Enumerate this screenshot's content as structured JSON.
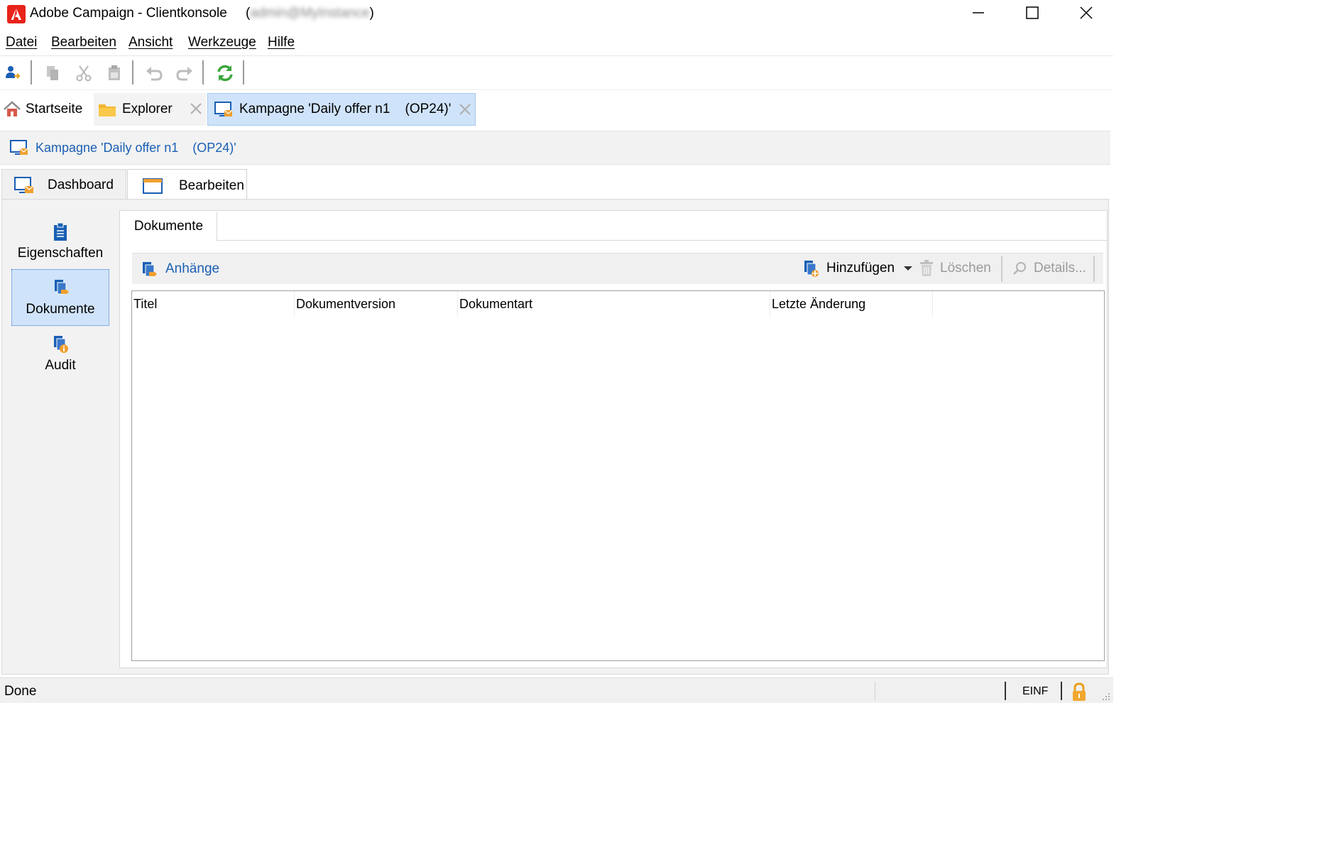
{
  "window": {
    "app_name": "Adobe Campaign",
    "title": "Adobe Campaign - Clientkonsole",
    "user_open": "(",
    "user_blurred": "admin@MyInstance",
    "user_close": ")",
    "minimize_icon": "minimize-icon",
    "maximize_icon": "maximize-icon",
    "close_icon": "close-icon"
  },
  "menu": {
    "items": [
      "Datei",
      "Bearbeiten",
      "Ansicht",
      "Werkzeuge",
      "Hilfe"
    ]
  },
  "toolbar": {
    "icons": [
      "connect-icon",
      "copy-icon",
      "cut-icon",
      "paste-icon",
      "undo-icon",
      "redo-icon",
      "refresh-icon"
    ]
  },
  "tabs": [
    {
      "label": "Startseite",
      "icon": "home-icon"
    },
    {
      "label": "Explorer",
      "icon": "folder-icon"
    },
    {
      "label": "Kampagne 'Daily offer n1    (OP24)'",
      "icon": "campaign-icon",
      "active": true
    }
  ],
  "breadcrumb": {
    "label": "Kampagne 'Daily offer n1    (OP24)'"
  },
  "main_tabs": [
    {
      "label": "Dashboard",
      "icon": "dashboard-icon"
    },
    {
      "label": "Bearbeiten",
      "icon": "edit-window-icon",
      "active": true
    }
  ],
  "sidebar": {
    "items": [
      {
        "label": "Eigenschaften",
        "icon": "clipboard-icon"
      },
      {
        "label": "Dokumente",
        "icon": "documents-icon",
        "selected": true
      },
      {
        "label": "Audit",
        "icon": "audit-icon"
      }
    ]
  },
  "content": {
    "subtab": "Dokumente",
    "list_title": "Anhänge",
    "add_label": "Hinzufügen",
    "delete_label": "Löschen",
    "details_label": "Details..."
  },
  "grid": {
    "columns": [
      "Titel",
      "Dokumentversion",
      "Dokumentart",
      "Letzte Änderung"
    ],
    "rows": []
  },
  "status": {
    "text": "Done",
    "mode": "EINF"
  },
  "colors": {
    "accent": "#1a5fb4",
    "logo_red": "#e8231a",
    "selected_bg": "#cfe3fa",
    "refresh_green": "#3aa63a"
  }
}
